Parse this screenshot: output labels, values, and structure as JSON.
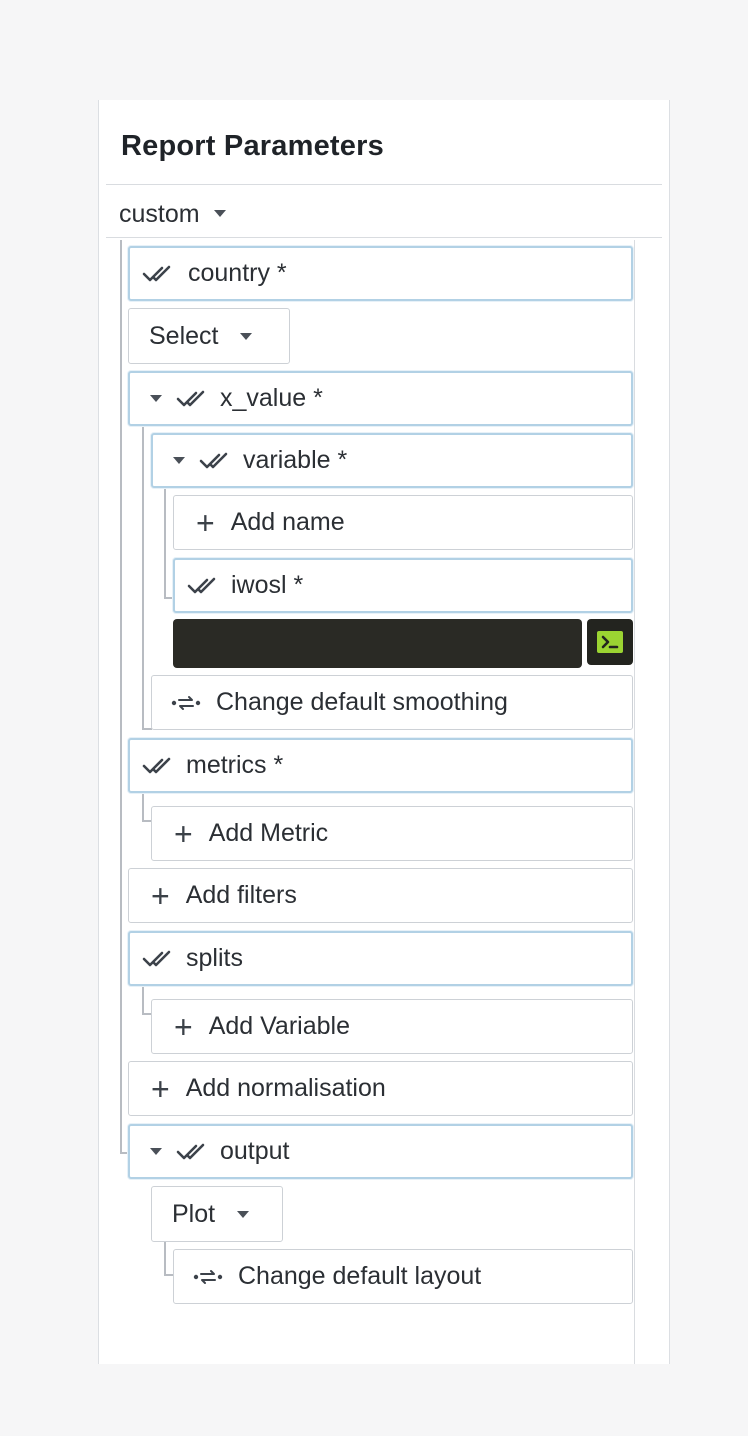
{
  "panel": {
    "title": "Report Parameters",
    "preset": "custom"
  },
  "tree": {
    "country_label": "country *",
    "country_select": "Select",
    "x_value_label": "x_value *",
    "variable_label": "variable *",
    "add_name": "Add name",
    "iwosl_label": "iwosl *",
    "iwosl_value": "",
    "change_smoothing": "Change default smoothing",
    "metrics_label": "metrics *",
    "add_metric": "Add Metric",
    "add_filters": "Add filters",
    "splits_label": "splits",
    "add_variable": "Add Variable",
    "add_normalisation": "Add normalisation",
    "output_label": "output",
    "output_select": "Plot",
    "change_layout": "Change default layout"
  },
  "colors": {
    "param_border": "#b2d1e5",
    "code_bg": "#2a2a25",
    "code_icon": "#9bd432"
  },
  "icons": [
    "check-double-icon",
    "chevron-down-icon",
    "plus-icon",
    "swap-arrows-icon",
    "terminal-icon"
  ]
}
